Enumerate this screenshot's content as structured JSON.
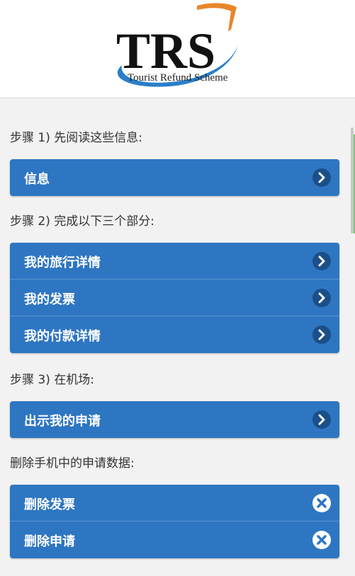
{
  "logo": {
    "letters": "TRS",
    "subtitle": "Tourist Refund Scheme"
  },
  "sections": [
    {
      "label": "步骤 1) 先阅读这些信息:",
      "buttons": [
        {
          "label": "信息",
          "icon": "chevron-right-icon"
        }
      ]
    },
    {
      "label": "步骤 2) 完成以下三个部分:",
      "buttons": [
        {
          "label": "我的旅行详情",
          "icon": "chevron-right-icon"
        },
        {
          "label": "我的发票",
          "icon": "chevron-right-icon"
        },
        {
          "label": "我的付款详情",
          "icon": "chevron-right-icon"
        }
      ]
    },
    {
      "label": "步骤 3) 在机场:",
      "buttons": [
        {
          "label": "出示我的申请",
          "icon": "chevron-right-icon"
        }
      ]
    },
    {
      "label": "删除手机中的申请数据:",
      "buttons": [
        {
          "label": "删除发票",
          "icon": "close-icon"
        },
        {
          "label": "删除申请",
          "icon": "close-icon"
        }
      ]
    }
  ],
  "colors": {
    "button_blue": "#2e76c2",
    "icon_dark": "#1b4f88",
    "logo_orange": "#e8862a",
    "logo_blue": "#2a7fc9"
  }
}
